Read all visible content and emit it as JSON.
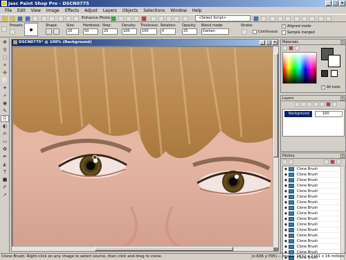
{
  "app": {
    "title": "Jasc Paint Shop Pro - DSCN0775",
    "window_buttons": [
      "_",
      "□",
      "×"
    ]
  },
  "menu": [
    "File",
    "Edit",
    "View",
    "Image",
    "Effects",
    "Adjust",
    "Layers",
    "Objects",
    "Selections",
    "Window",
    "Help"
  ],
  "toolbar": {
    "enhance_label": "Enhance Photo ▾",
    "script_select": "<Select Script>"
  },
  "tool_options": {
    "presets_label": "Presets:",
    "shape_label": "Shape:",
    "size_label": "Size:",
    "size_value": "20",
    "hardness_label": "Hardness:",
    "hardness_value": "50",
    "step_label": "Step:",
    "step_value": "25",
    "density_label": "Density:",
    "density_value": "100",
    "thickness_label": "Thickness:",
    "thickness_value": "100",
    "rotation_label": "Rotation:",
    "rotation_value": "0",
    "opacity_label": "Opacity:",
    "opacity_value": "25",
    "blend_label": "Blend mode:",
    "blend_value": "Darken",
    "stroke_label": "Stroke:",
    "continuous_label": "Continuous",
    "aligned_label": "Aligned mode",
    "sample_merged_label": "Sample merged"
  },
  "document": {
    "title": "DSCN0775* @ 100% (Background)"
  },
  "materials": {
    "title": "Materials",
    "all_tools_label": "All tools",
    "colors": {
      "foreground": "#555555",
      "background": "#ffffff"
    }
  },
  "layers": {
    "title": "Layers",
    "rows": [
      {
        "name": "Background",
        "opacity": "100"
      }
    ]
  },
  "history": {
    "title": "History",
    "items": [
      "Clone Brush",
      "Clone Brush",
      "Clone Brush",
      "Clone Brush",
      "Clone Brush",
      "Clone Brush",
      "Clone Brush",
      "Clone Brush",
      "Clone Brush",
      "Clone Brush",
      "Clone Brush",
      "Clone Brush",
      "Clone Brush",
      "Clone Brush",
      "Clone Brush",
      "Clone Brush",
      "Clone Brush"
    ]
  },
  "status": {
    "message": "Clone Brush: Right-click on any image to select source, then click and drag to clone.",
    "info": "(x:636 y:795) -- Image: 1632 x 2161 x 16 million"
  }
}
